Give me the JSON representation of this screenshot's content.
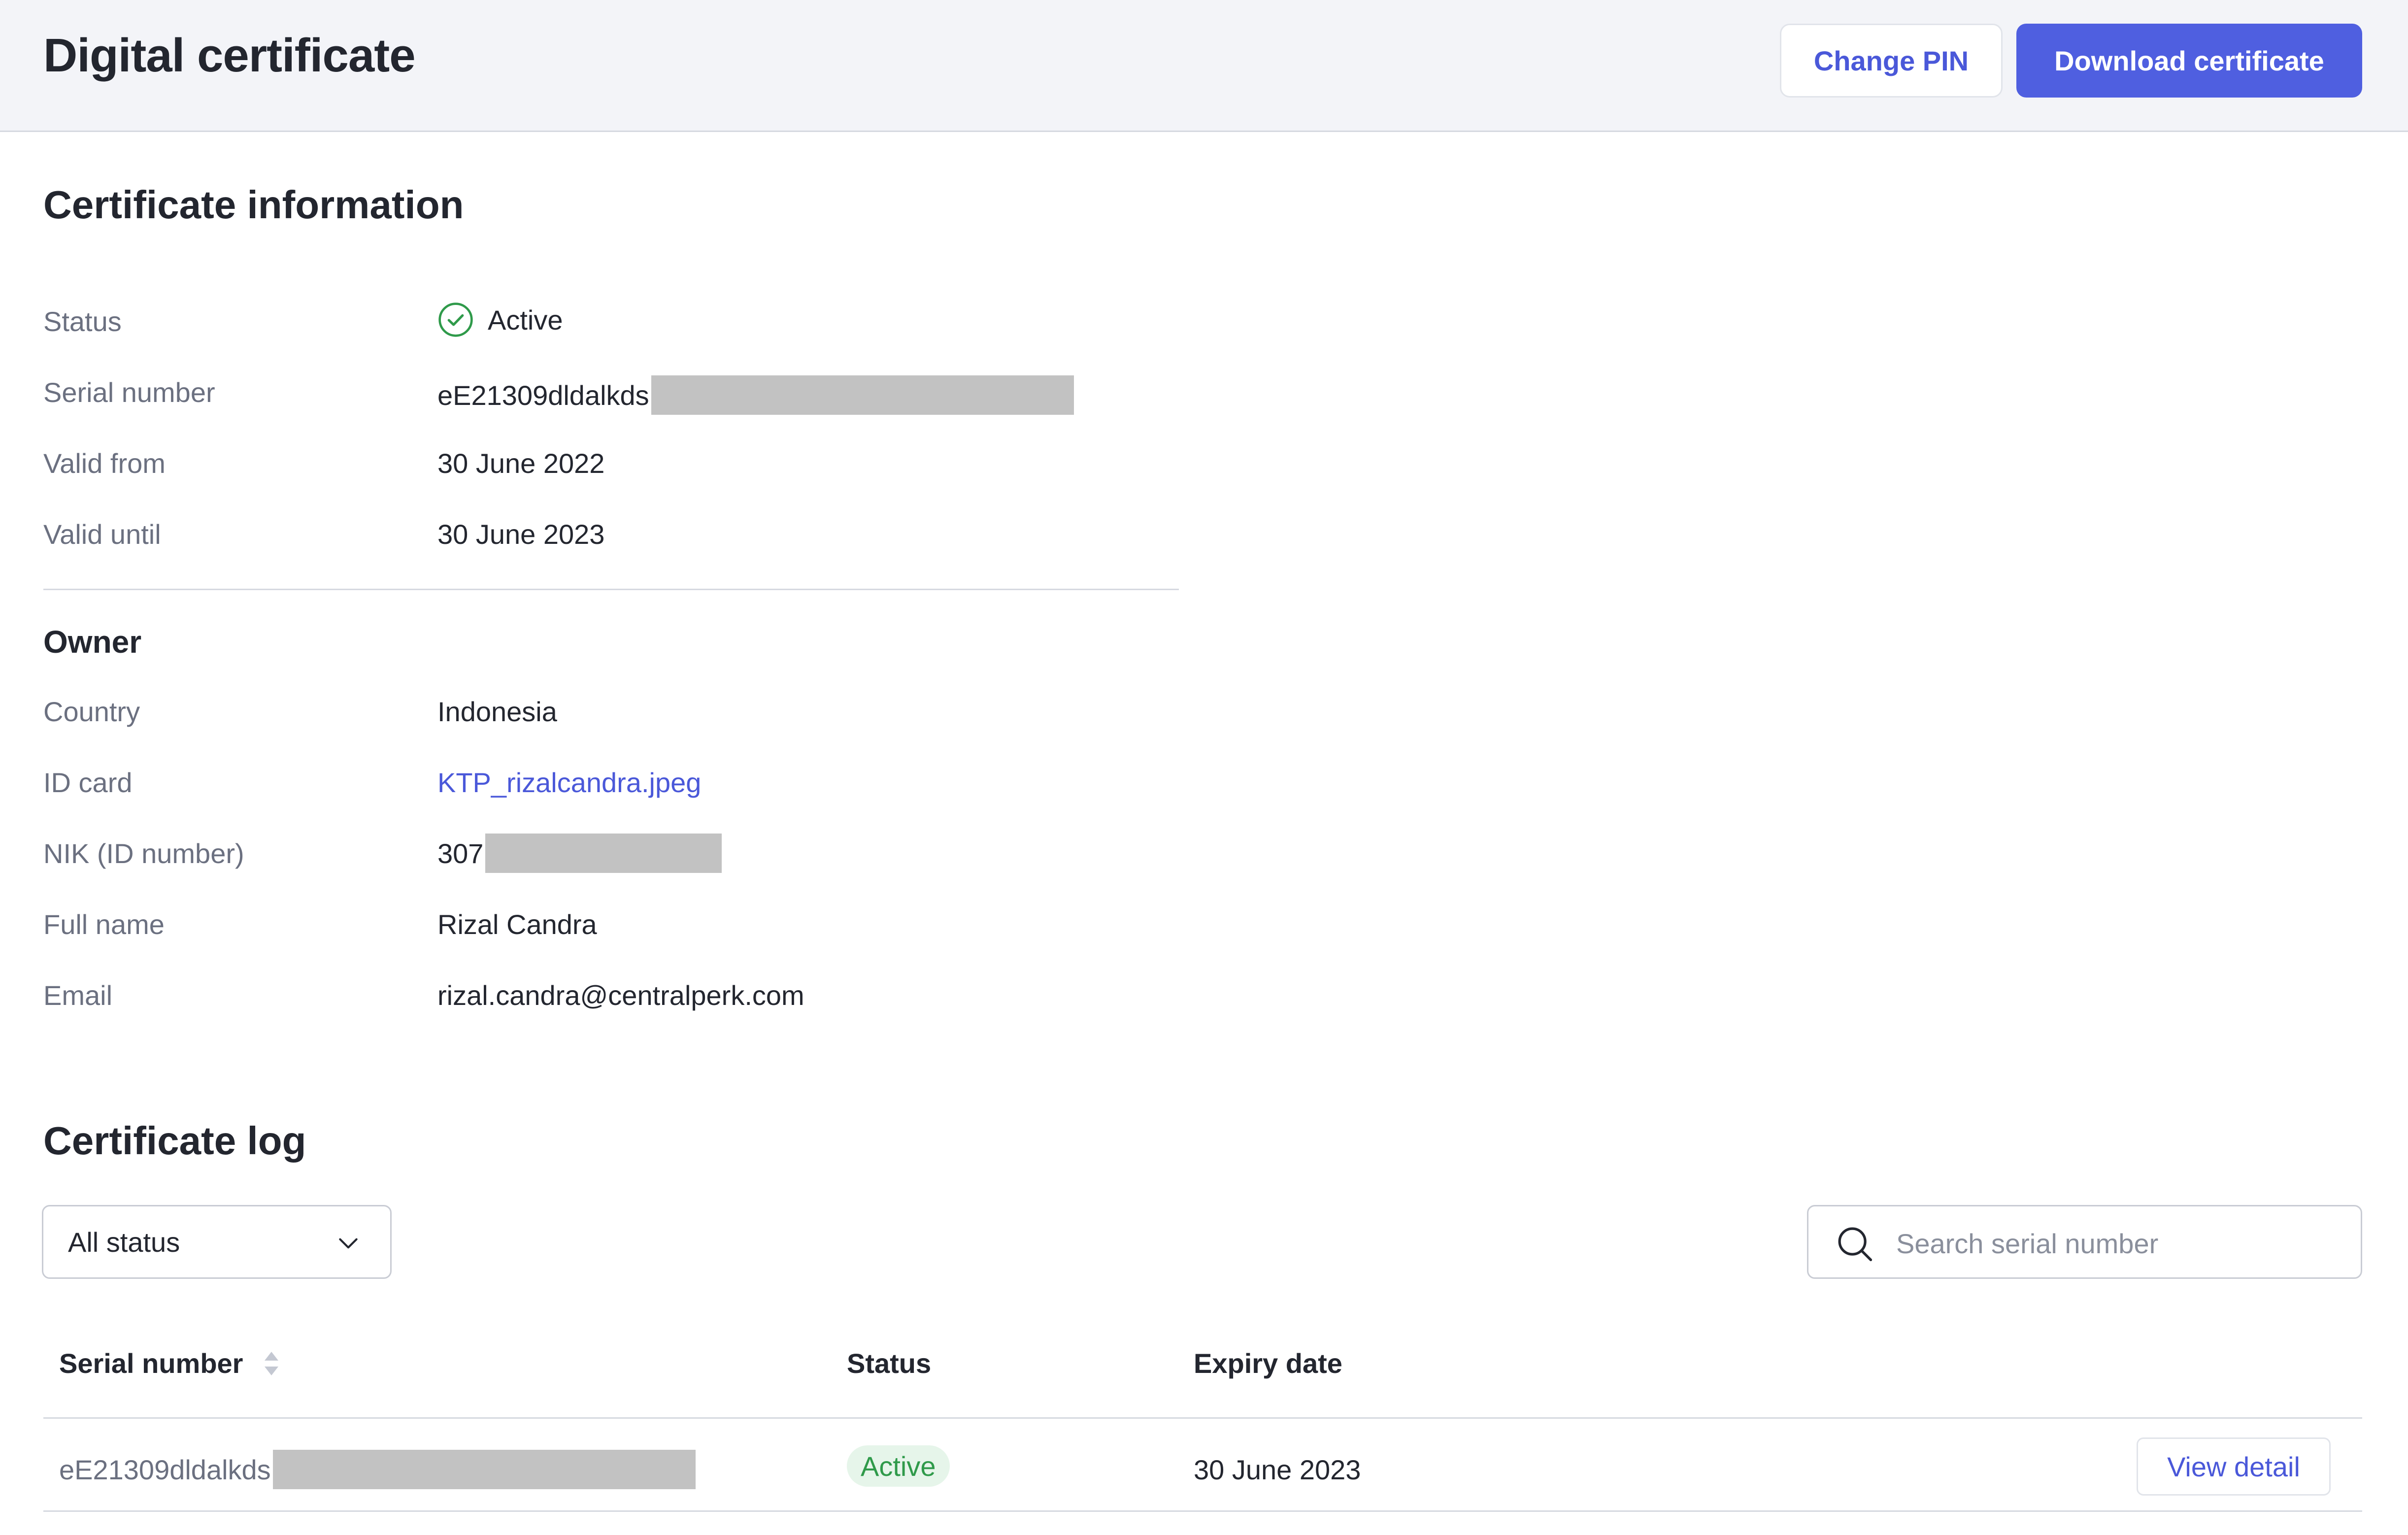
{
  "header": {
    "title": "Digital certificate",
    "change_pin_label": "Change PIN",
    "download_label": "Download certificate"
  },
  "certificate_info": {
    "title": "Certificate information",
    "rows": [
      {
        "label": "Status",
        "value": "Active",
        "status_color": "#2f9a4a"
      },
      {
        "label": "Serial number",
        "value": "eE21309dldalkds"
      },
      {
        "label": "Valid from",
        "value": "30 June 2022"
      },
      {
        "label": "Valid until",
        "value": "30 June 2023"
      }
    ]
  },
  "owner": {
    "title": "Owner",
    "rows": [
      {
        "label": "Country",
        "value": "Indonesia"
      },
      {
        "label": "ID card",
        "value": "KTP_rizalcandra.jpeg"
      },
      {
        "label": "NIK (ID number)",
        "value": "307"
      },
      {
        "label": "Full name",
        "value": "Rizal Candra"
      },
      {
        "label": "Email",
        "value": "rizal.candra@centralperk.com"
      }
    ]
  },
  "log": {
    "title": "Certificate log",
    "filter_value": "All status",
    "search_placeholder": "Search serial number",
    "columns": [
      "Serial number",
      "Status",
      "Expiry date"
    ],
    "rows": [
      {
        "serial": "eE21309dldalkds",
        "status": "Active",
        "expiry": "30 June 2023",
        "action": "View detail"
      }
    ]
  },
  "colors": {
    "primary": "#4f5fe0",
    "link": "#4a58d9",
    "success": "#2f9a4a",
    "header_bg": "#f3f4f8"
  }
}
